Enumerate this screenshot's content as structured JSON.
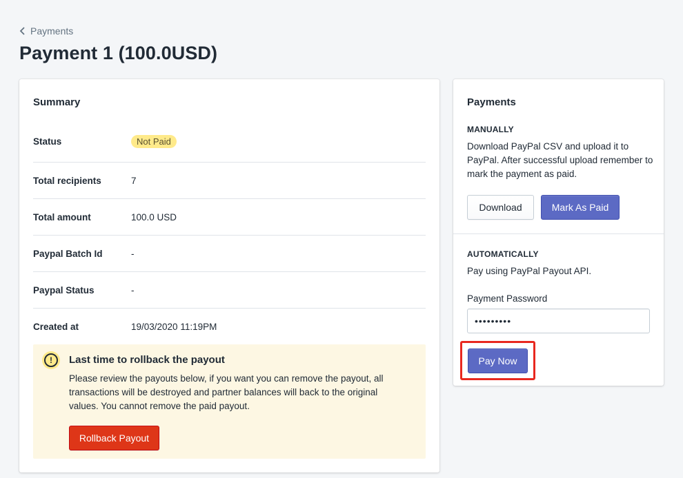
{
  "breadcrumb": {
    "label": "Payments"
  },
  "page_title": "Payment 1 (100.0USD)",
  "summary": {
    "title": "Summary",
    "rows": [
      {
        "label": "Status",
        "value": "Not Paid"
      },
      {
        "label": "Total recipients",
        "value": "7"
      },
      {
        "label": "Total amount",
        "value": "100.0 USD"
      },
      {
        "label": "Paypal Batch Id",
        "value": "-"
      },
      {
        "label": "Paypal Status",
        "value": "-"
      },
      {
        "label": "Created at",
        "value": "19/03/2020 11:19PM"
      }
    ],
    "banner": {
      "icon": "alert-circle-icon",
      "title": "Last time to rollback the payout",
      "text": "Please review the payouts below, if you want you can remove the payout, all transactions will be destroyed and partner balances will back to the original values. You cannot remove the paid payout.",
      "button_label": "Rollback Payout"
    }
  },
  "payments": {
    "title": "Payments",
    "manually": {
      "heading": "MANUALLY",
      "text": "Download PayPal CSV and upload it to PayPal. After successful upload remember to mark the payment as paid.",
      "download_label": "Download",
      "mark_paid_label": "Mark As Paid"
    },
    "automatically": {
      "heading": "AUTOMATICALLY",
      "text": "Pay using PayPal Payout API.",
      "password_label": "Payment Password",
      "password_value": "•••••••••",
      "pay_now_label": "Pay Now"
    }
  },
  "colors": {
    "primary": "#5c6ac4",
    "danger": "#de3618",
    "warning_badge": "#ffea8a",
    "highlight_outline": "#e8281f"
  }
}
